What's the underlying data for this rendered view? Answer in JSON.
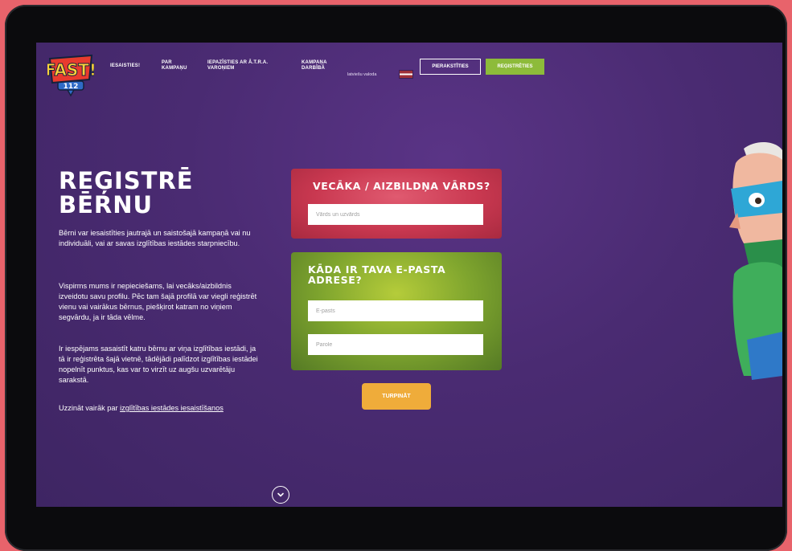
{
  "logo": {
    "text": "FAST!",
    "number": "112"
  },
  "nav": {
    "items": [
      {
        "label_lines": [
          "IESAISTIES!"
        ]
      },
      {
        "label_lines": [
          "PAR",
          "KAMPAŅU"
        ]
      },
      {
        "label_lines": [
          "IEPAZĪSTIES AR Ā.T.R.A.",
          "VAROŅIEM"
        ]
      },
      {
        "label_lines": [
          "KAMPAŅA",
          "DARBĪBĀ"
        ]
      }
    ],
    "language": "latviešu valoda",
    "login_label": "PIERAKSTĪTIES",
    "register_label": "REĢISTRĒTIES"
  },
  "main": {
    "title_line1": "REĢISTRĒ",
    "title_line2": "BĒRNU",
    "paragraphs": [
      "Bērni var iesaistīties jautrajā un saistošajā kampaņā vai nu individuāli, vai ar savas izglītības iestādes starpniecību.",
      "Vispirms mums ir nepieciešams, lai vecāks/aizbildnis izveidotu savu profilu. Pēc tam šajā profilā var viegli reģistrēt vienu vai vairākus bērnus, piešķirot katram no viņiem segvārdu, ja ir tāda vēlme.",
      "Ir iespējams sasaistīt katru bērnu ar viņa izglītības iestādi, ja tā ir reģistrēta šajā vietnē, tādējādi palīdzot izglītības iestādei nopelnīt punktus, kas var to virzīt uz augšu uzvarētāju sarakstā."
    ],
    "more_prefix": "Uzzināt vairāk par ",
    "more_link": "izglītības iestādes iesaistīšanos"
  },
  "form": {
    "parent_title": "VECĀKA / AIZBILDŅA VĀRDS?",
    "name_placeholder": "Vārds un uzvārds",
    "email_title_line1": "KĀDA IR TAVA E-PASTA",
    "email_title_line2": "ADRESE?",
    "email_placeholder": "E-pasts",
    "password_placeholder": "Parole",
    "continue_label": "TURPINĀT"
  },
  "colors": {
    "background": "#4a2b72",
    "red_card": "#c93850",
    "green_card": "#7fa52e",
    "accent_green": "#8dbb3a",
    "continue_orange": "#efac3a"
  },
  "icons": {
    "scroll": "chevron-down-icon",
    "flag": "latvia-flag-icon"
  }
}
